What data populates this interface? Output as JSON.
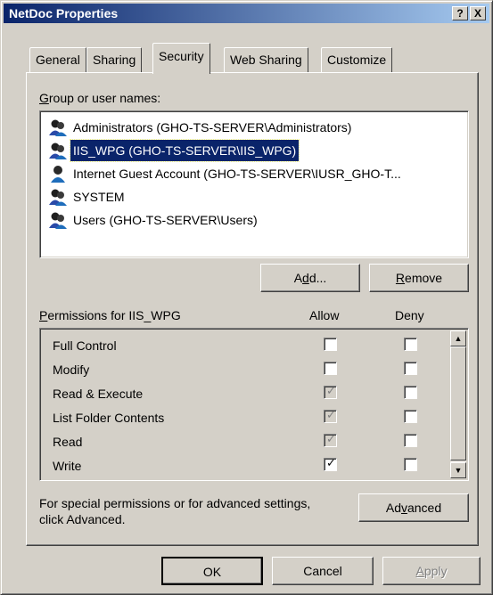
{
  "window": {
    "title": "NetDoc Properties",
    "help_btn": "?",
    "close_btn": "X"
  },
  "tabs": [
    {
      "label": "General",
      "active": false
    },
    {
      "label": "Sharing",
      "active": false
    },
    {
      "label": "Security",
      "active": true
    },
    {
      "label": "Web Sharing",
      "active": false
    },
    {
      "label": "Customize",
      "active": false
    }
  ],
  "security": {
    "group_label_accel": "G",
    "group_label_rest": "roup or user names:",
    "users": [
      {
        "name": "Administrators (GHO-TS-SERVER\\Administrators)",
        "icon": "group-icon",
        "selected": false
      },
      {
        "name": "IIS_WPG (GHO-TS-SERVER\\IIS_WPG)",
        "icon": "group-icon",
        "selected": true
      },
      {
        "name": "Internet Guest Account (GHO-TS-SERVER\\IUSR_GHO-T...",
        "icon": "user-icon",
        "selected": false
      },
      {
        "name": "SYSTEM",
        "icon": "group-icon",
        "selected": false
      },
      {
        "name": "Users (GHO-TS-SERVER\\Users)",
        "icon": "group-icon",
        "selected": false
      }
    ],
    "add_pre": "A",
    "add_accel": "d",
    "add_post": "d...",
    "remove_accel": "R",
    "remove_rest": "emove",
    "perm_label_accel": "P",
    "perm_label_rest": "ermissions for IIS_WPG",
    "allow_header": "Allow",
    "deny_header": "Deny",
    "permissions": [
      {
        "name": "Full Control",
        "allow": "unchecked",
        "deny": "unchecked"
      },
      {
        "name": "Modify",
        "allow": "unchecked",
        "deny": "unchecked"
      },
      {
        "name": "Read & Execute",
        "allow": "checked-disabled",
        "deny": "unchecked"
      },
      {
        "name": "List Folder Contents",
        "allow": "checked-disabled",
        "deny": "unchecked"
      },
      {
        "name": "Read",
        "allow": "checked-disabled",
        "deny": "unchecked"
      },
      {
        "name": "Write",
        "allow": "checked",
        "deny": "unchecked"
      }
    ],
    "special_text_line1": "For special permissions or for advanced settings,",
    "special_text_line2": "click Advanced.",
    "advanced_pre": "Ad",
    "advanced_accel": "v",
    "advanced_post": "anced"
  },
  "footer": {
    "ok_label": "OK",
    "cancel_label": "Cancel",
    "apply_accel": "A",
    "apply_rest": "pply"
  },
  "colors": {
    "selection": "#0a246a",
    "face": "#d4d0c8"
  }
}
